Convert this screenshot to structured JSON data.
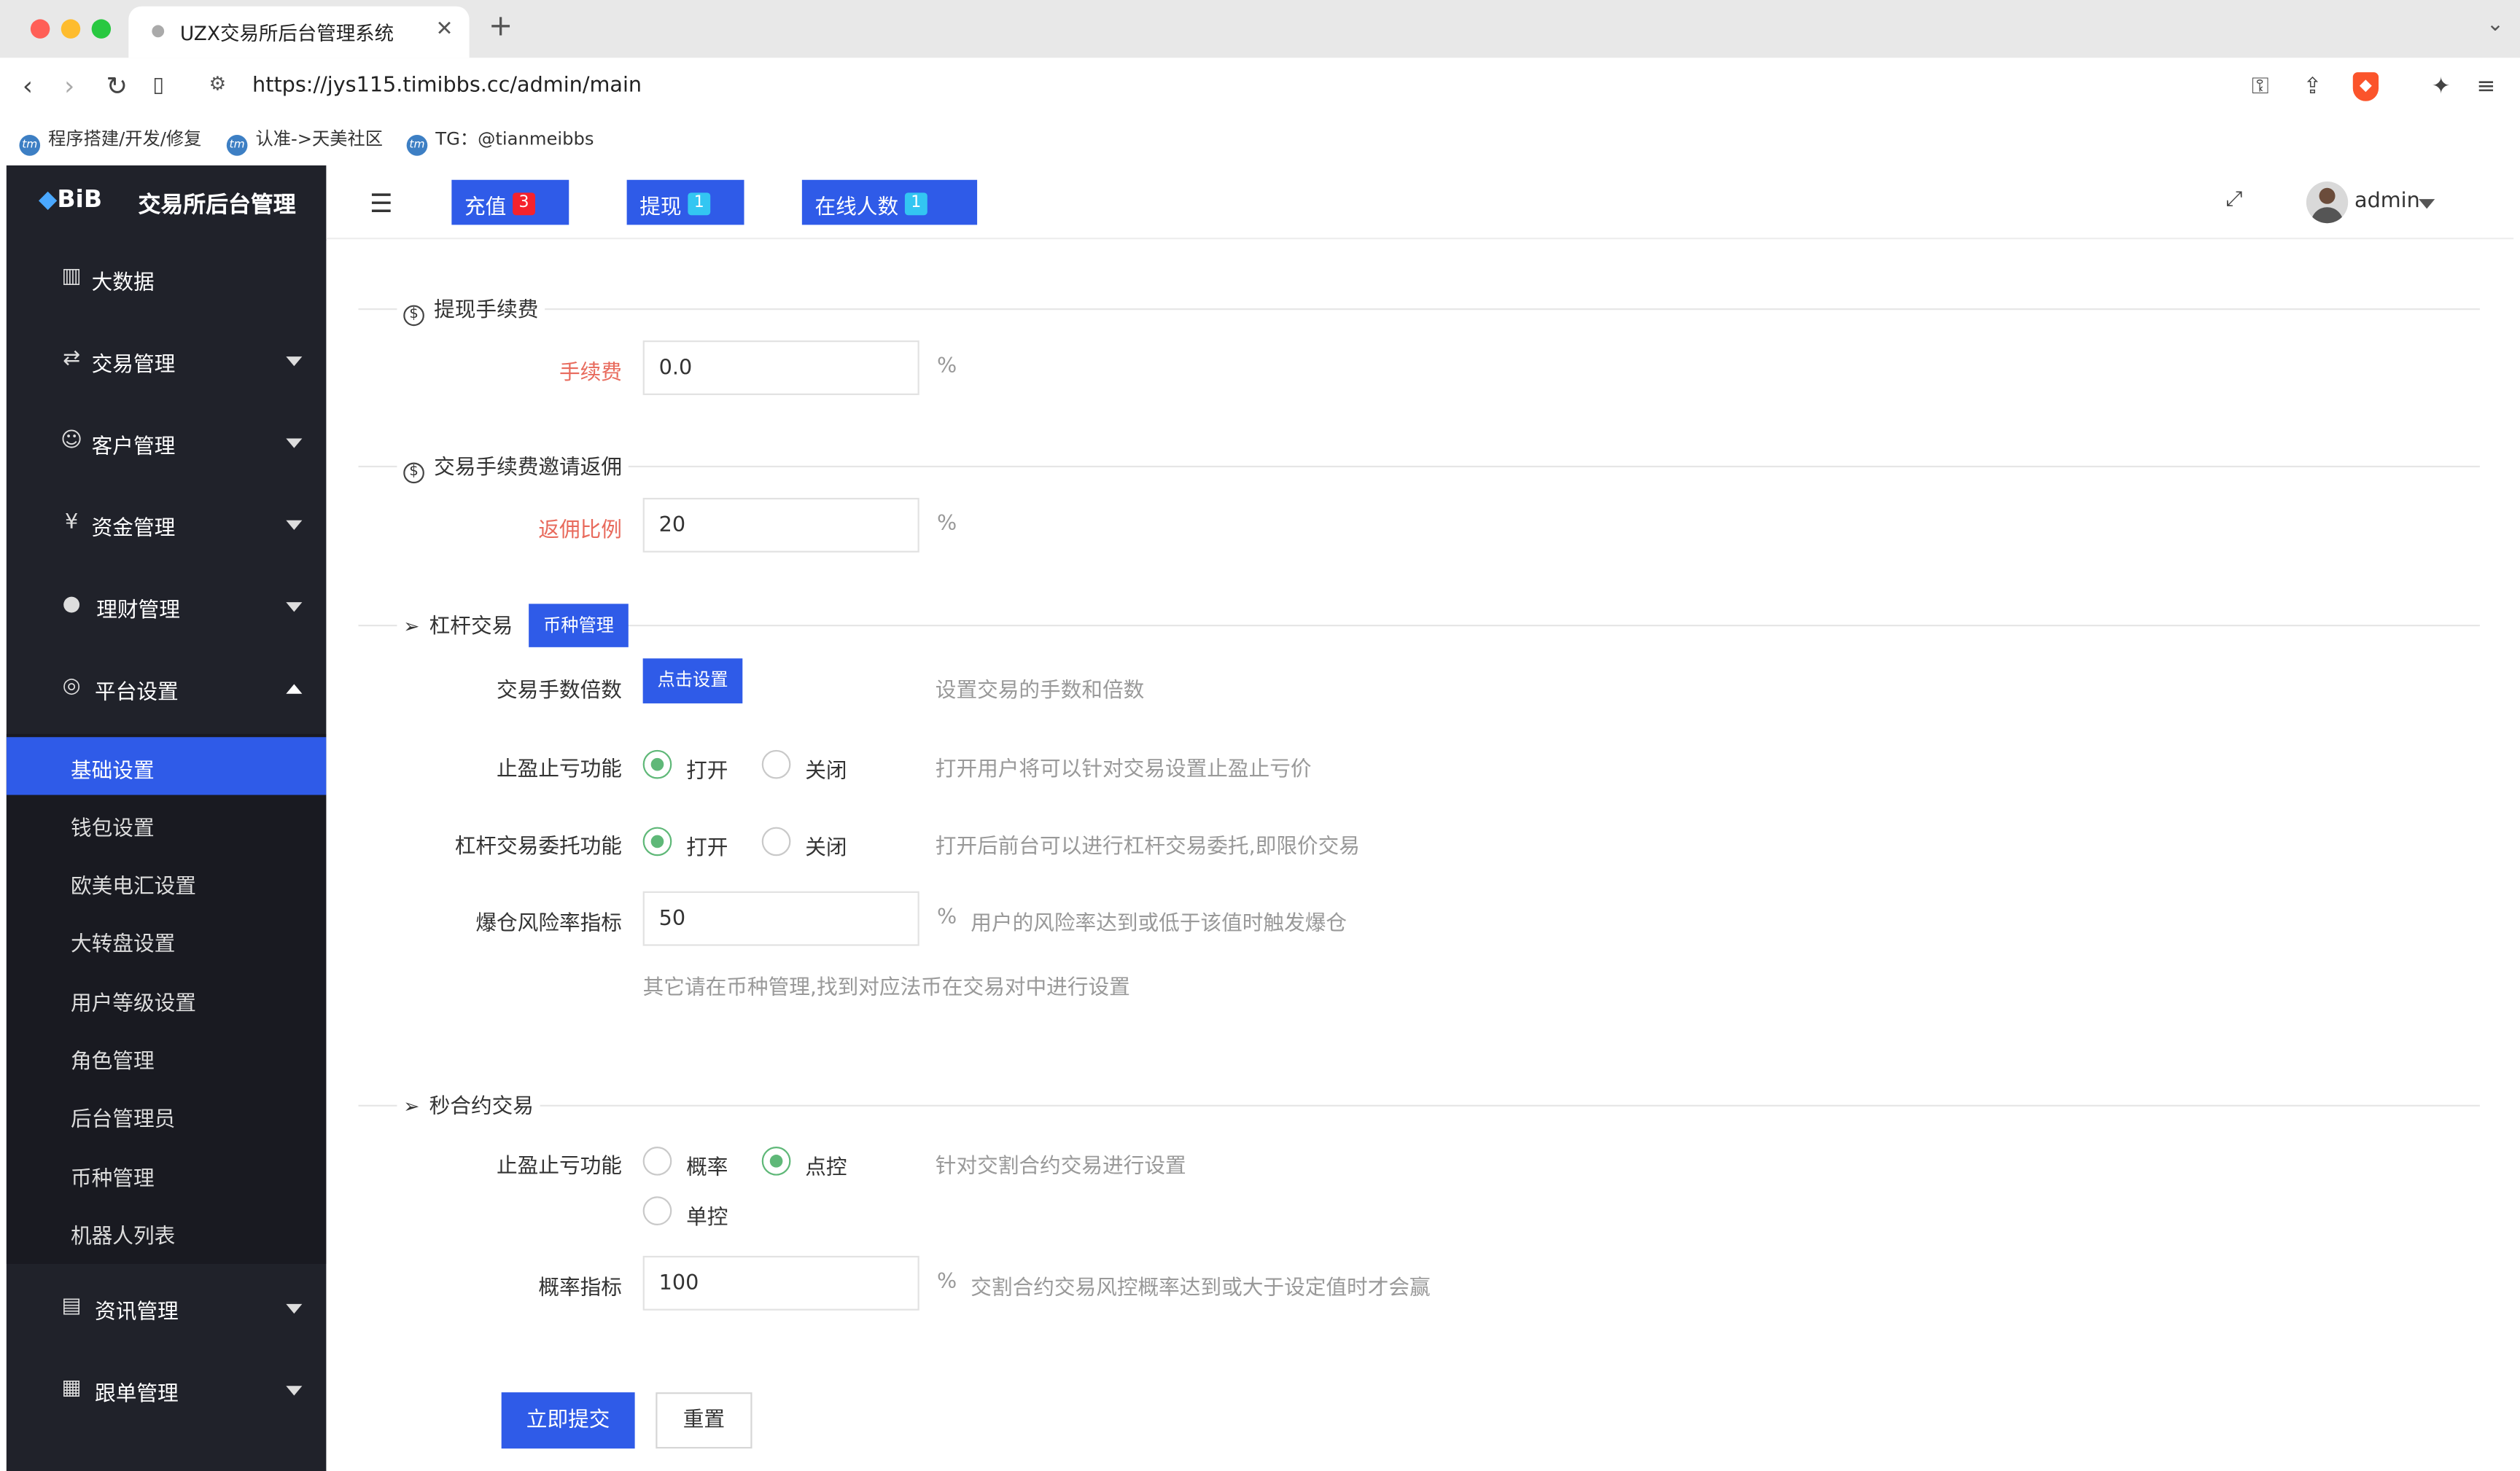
{
  "browser": {
    "tab_title": "UZX交易所后台管理系统",
    "url": "https://jys115.timibbs.cc/admin/main",
    "bookmarks": [
      "程序搭建/开发/修复",
      "认准->天美社区",
      "TG：@tianmeibbs"
    ],
    "traffic_colors": [
      "#ff5f57",
      "#febc2e",
      "#28c840"
    ]
  },
  "sidebar": {
    "logo": "BiB",
    "title": "交易所后台管理",
    "menu": [
      {
        "label": "大数据",
        "icon": "chart-icon"
      },
      {
        "label": "交易管理",
        "icon": "exchange-icon"
      },
      {
        "label": "客户管理",
        "icon": "users-icon"
      },
      {
        "label": "资金管理",
        "icon": "money-bag-icon"
      },
      {
        "label": "理财管理",
        "icon": "piggy-bank-icon"
      },
      {
        "label": "平台设置",
        "icon": "settings-icon"
      }
    ],
    "submenu": [
      "基础设置",
      "钱包设置",
      "欧美电汇设置",
      "大转盘设置",
      "用户等级设置",
      "角色管理",
      "后台管理员",
      "币种管理",
      "机器人列表"
    ],
    "menu_bottom": [
      {
        "label": "资讯管理",
        "icon": "news-icon"
      },
      {
        "label": "跟单管理",
        "icon": "document-icon"
      }
    ],
    "active_color": "#2f5be8"
  },
  "header": {
    "recharge": {
      "label": "充值",
      "count": "3"
    },
    "withdraw": {
      "label": "提现",
      "count": "1"
    },
    "online": {
      "label": "在线人数",
      "count": "1"
    },
    "username": "admin"
  },
  "form": {
    "withdraw_fee": {
      "legend": "提现手续费",
      "label": "手续费",
      "value": "0.0",
      "unit": "%"
    },
    "rebate": {
      "legend": "交易手续费邀请返佣",
      "label": "返佣比例",
      "value": "20",
      "unit": "%"
    },
    "leverage": {
      "legend": "杠杆交易",
      "coin_btn": "币种管理",
      "multiplier_label": "交易手数倍数",
      "multiplier_btn": "点击设置",
      "multiplier_hint": "设置交易的手数和倍数",
      "stop_label": "止盈止亏功能",
      "stop_hint": "打开用户将可以针对交易设置止盈止亏价",
      "entrust_label": "杠杆交易委托功能",
      "entrust_hint": "打开后前台可以进行杠杆交易委托,即限价交易",
      "open": "打开",
      "close": "关闭",
      "risk_label": "爆仓风险率指标",
      "risk_value": "50",
      "risk_unit": "%",
      "risk_hint": "用户的风险率达到或低于该值时触发爆仓",
      "note": "其它请在币种管理,找到对应法币在交易对中进行设置"
    },
    "second": {
      "legend": "秒合约交易",
      "stop_label": "止盈止亏功能",
      "opt_prob": "概率",
      "opt_point": "点控",
      "opt_single": "单控",
      "stop_hint": "针对交割合约交易进行设置",
      "prob_label": "概率指标",
      "prob_value": "100",
      "prob_unit": "%",
      "prob_hint": "交割合约交易风控概率达到或大于设定值时才会赢"
    },
    "submit": "立即提交",
    "reset": "重置"
  }
}
